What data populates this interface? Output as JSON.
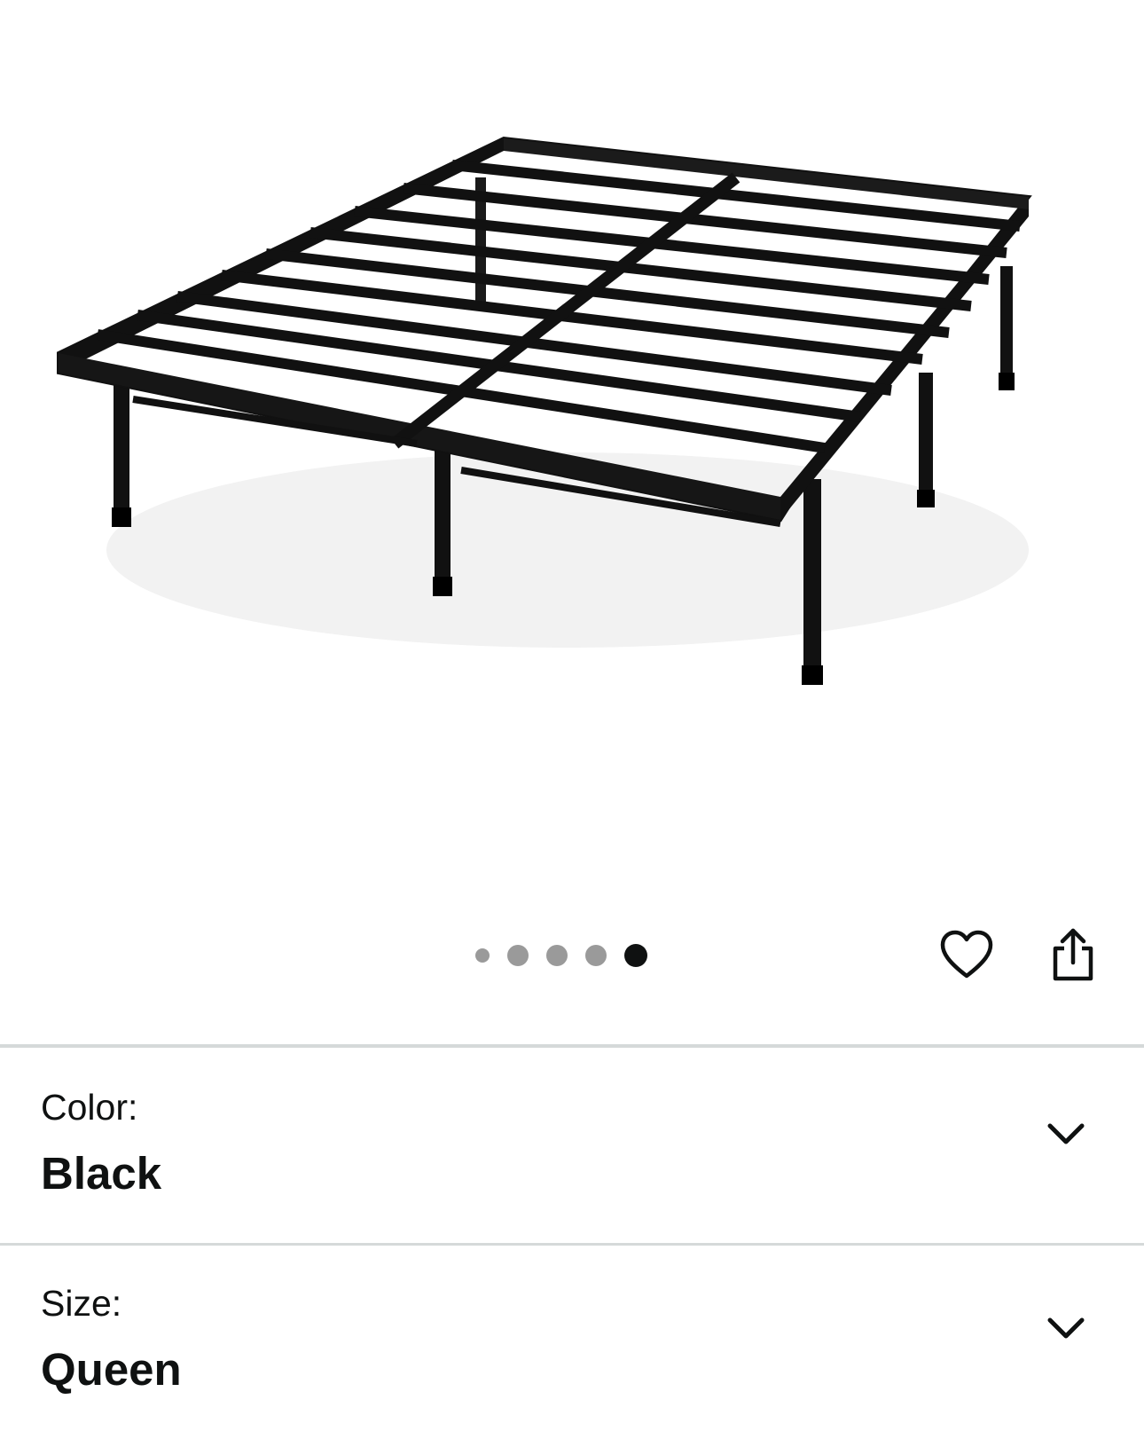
{
  "product_image": {
    "icon": "bed-frame-image",
    "alt": "Black metal bed frame"
  },
  "carousel": {
    "count": 5,
    "active_index": 4
  },
  "actions": {
    "wishlist_icon": "heart-icon",
    "share_icon": "share-icon"
  },
  "variations": [
    {
      "label": "Color:",
      "value": "Black"
    },
    {
      "label": "Size:",
      "value": "Queen"
    }
  ],
  "colors": {
    "text": "#0f1111",
    "divider": "#d5d9d9",
    "dot_inactive": "#9a9a9a",
    "dot_active": "#0f1111"
  }
}
